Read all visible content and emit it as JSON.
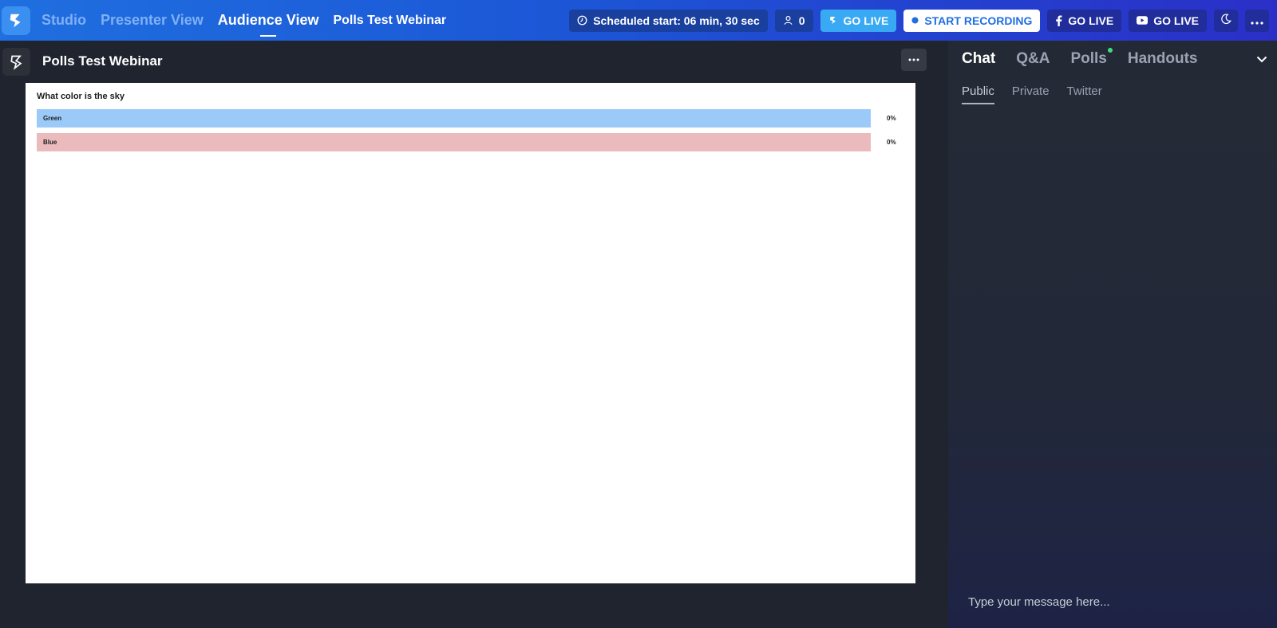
{
  "topbar": {
    "nav": [
      "Studio",
      "Presenter View",
      "Audience View"
    ],
    "webinar_title": "Polls Test Webinar",
    "schedule_label": "Scheduled start: 06 min, 30 sec",
    "attendee_count": "0",
    "go_live": "GO LIVE",
    "start_recording": "START RECORDING",
    "facebook_go_live": "GO LIVE",
    "youtube_go_live": "GO LIVE"
  },
  "left": {
    "title": "Polls Test Webinar",
    "more": "···"
  },
  "poll": {
    "question": "What color is the sky",
    "options": [
      {
        "label": "Green",
        "percent": "0%",
        "color": "#9bcaf8"
      },
      {
        "label": "Blue",
        "percent": "0%",
        "color": "#eababd"
      }
    ]
  },
  "panel": {
    "tabs": [
      "Chat",
      "Q&A",
      "Polls",
      "Handouts"
    ],
    "sub_tabs": [
      "Public",
      "Private",
      "Twitter"
    ],
    "input_placeholder": "Type your message here..."
  },
  "colors": {
    "accent": "#1f6fe0",
    "live_blue": "#39a9f4",
    "online_dot": "#3ddc84"
  }
}
